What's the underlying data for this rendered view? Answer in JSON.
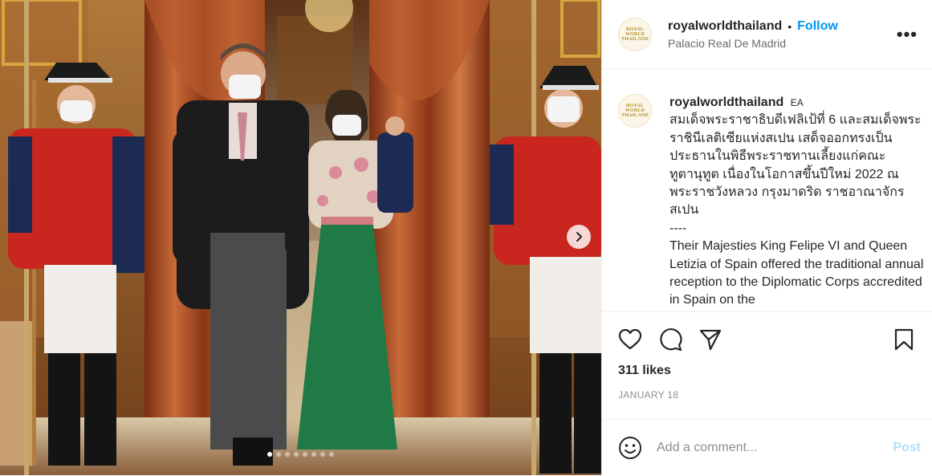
{
  "post": {
    "username": "royalworldthailand",
    "separator": "•",
    "follow_label": "Follow",
    "location": "Palacio Real De Madrid",
    "more_label": "•••",
    "avatar_text": "ROYAL WORLD THAILAND"
  },
  "caption": {
    "username": "royalworldthailand",
    "badge": "EA",
    "thai_text": "สมเด็จพระราชาธิบดีเฟลิเป้ที่ 6 และสมเด็จพระราชินีเลติเซียแห่งสเปน เสด็จออกทรงเป็นประธานในพิธีพระราชทานเลี้ยงแก่คณะทูตานุทูต เนื่องในโอกาสขึ้นปีใหม่ 2022 ณ พระราชวังหลวง กรุงมาดริด ราชอาณาจักรสเปน",
    "divider": "----",
    "english_text": "Their Majesties King Felipe VI and Queen Letizia of Spain offered the traditional annual reception to the Diplomatic Corps accredited in Spain on the"
  },
  "engagement": {
    "likes": "311 likes",
    "date": "JANUARY 18"
  },
  "comment": {
    "placeholder": "Add a comment...",
    "post_label": "Post"
  },
  "carousel": {
    "slide_count": 8,
    "active_index": 0
  },
  "icons": {
    "like": "heart-icon",
    "comment": "comment-icon",
    "share": "paper-plane-icon",
    "save": "bookmark-icon",
    "emoji": "smiley-icon",
    "next": "chevron-right-icon"
  },
  "colors": {
    "follow": "#0095f6",
    "post_disabled": "#b2dffc",
    "muted_text": "#8e8e8e"
  }
}
